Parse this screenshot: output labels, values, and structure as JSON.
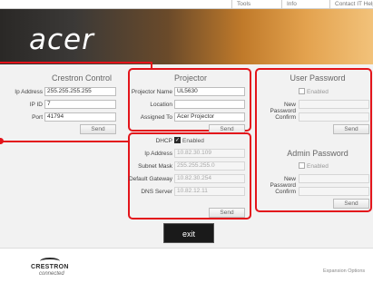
{
  "nav": {
    "tools": "Tools",
    "info": "Info",
    "contact": "Contact IT Help"
  },
  "brand": {
    "logo": "acer"
  },
  "crestron": {
    "title": "Crestron Control",
    "ip_label": "Ip Address",
    "ip_value": "255.255.255.255",
    "ipid_label": "IP ID",
    "ipid_value": "7",
    "port_label": "Port",
    "port_value": "41794",
    "send": "Send"
  },
  "projector": {
    "title": "Projector",
    "name_label": "Projector Name",
    "name_value": "UL5630",
    "location_label": "Location",
    "location_value": "",
    "assigned_label": "Assigned To",
    "assigned_value": "Acer Projector",
    "send": "Send"
  },
  "network": {
    "dhcp_label": "DHCP",
    "dhcp_checked": true,
    "dhcp_enabled": "Enabled",
    "ip_label": "Ip Address",
    "ip_value": "10.82.30.109",
    "subnet_label": "Subnet Mask",
    "subnet_value": "255.255.255.0",
    "gateway_label": "Default Gateway",
    "gateway_value": "10.82.30.254",
    "dns_label": "DNS Server",
    "dns_value": "10.82.12.11",
    "send": "Send"
  },
  "user_password": {
    "title": "User Password",
    "enabled": "Enabled",
    "new_label": "New Password",
    "confirm_label": "Confirm",
    "send": "Send"
  },
  "admin_password": {
    "title": "Admin Password",
    "enabled": "Enabled",
    "new_label": "New Password",
    "confirm_label": "Confirm",
    "send": "Send"
  },
  "exit": "exit",
  "footer": {
    "crestron_name": "CRESTRON",
    "crestron_sub": "connected",
    "expansion": "Expansion Options"
  },
  "colors": {
    "highlight": "#e3141b",
    "accent_orange": "#e3a24e"
  }
}
